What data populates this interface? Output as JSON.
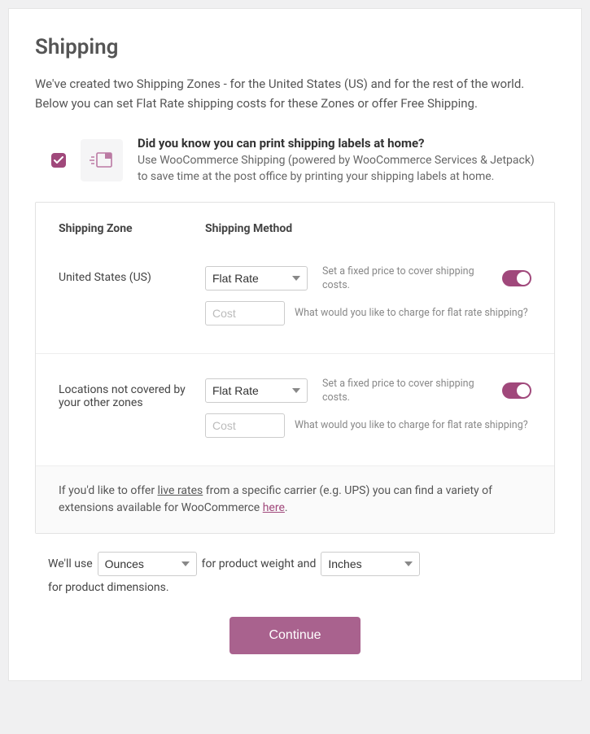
{
  "title": "Shipping",
  "intro": "We've created two Shipping Zones - for the United States (US) and for the rest of the world. Below you can set Flat Rate shipping costs for these Zones or offer Free Shipping.",
  "callout": {
    "heading": "Did you know you can print shipping labels at home?",
    "body": "Use WooCommerce Shipping (powered by WooCommerce Services & Jetpack) to save time at the post office by printing your shipping labels at home."
  },
  "headers": {
    "zone": "Shipping Zone",
    "method": "Shipping Method"
  },
  "methodOptions": [
    "Flat Rate"
  ],
  "zones": [
    {
      "name": "United States (US)",
      "method": "Flat Rate",
      "methodHint": "Set a fixed price to cover shipping costs.",
      "costPlaceholder": "Cost",
      "costHint": "What would you like to charge for flat rate shipping?"
    },
    {
      "name": "Locations not covered by your other zones",
      "method": "Flat Rate",
      "methodHint": "Set a fixed price to cover shipping costs.",
      "costPlaceholder": "Cost",
      "costHint": "What would you like to charge for flat rate shipping?"
    }
  ],
  "footnote": {
    "pre": "If you'd like to offer ",
    "liveRates": "live rates",
    "mid": " from a specific carrier (e.g. UPS) you can find a variety of extensions available for WooCommerce ",
    "link": "here",
    "post": "."
  },
  "units": {
    "pre": "We'll use",
    "weight": "Ounces",
    "mid": "for product weight and",
    "dim": "Inches",
    "post": "for product dimensions."
  },
  "continue": "Continue"
}
